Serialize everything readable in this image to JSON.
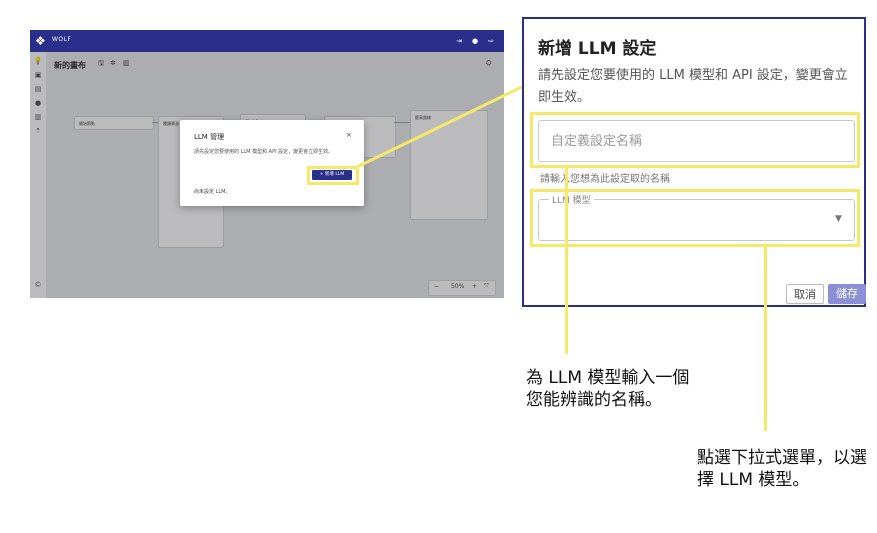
{
  "colors": {
    "brand": "#2b2f8c",
    "highlight": "#f5e96a",
    "save_disabled": "#8d8fd6"
  },
  "app": {
    "brand": "WOLF",
    "header_icons": [
      "login-icon",
      "user-icon",
      "logout-icon"
    ],
    "rail_icons": [
      "bulb-icon",
      "robot-icon",
      "book-icon",
      "chat-icon",
      "document-icon",
      "dot-icon",
      "help-icon"
    ],
    "canvas_title": "新的畫布",
    "toolbar_icons": [
      "save-icon",
      "settings-icon",
      "delete-icon"
    ],
    "nodes": [
      {
        "title": "開始節點"
      },
      {
        "title": "種類資源"
      },
      {
        "title": "Chat Bot"
      },
      {
        "title": "Chat Bot 摘要"
      },
      {
        "title": "聽寫器樣"
      }
    ],
    "zoom": {
      "minus": "−",
      "level": "50%",
      "plus": "+",
      "fit": "⤧"
    }
  },
  "modal": {
    "title": "LLM 管理",
    "close": "×",
    "description": "請先設定您要使用的 LLM 模型和 API 設定，變更會立即生效。",
    "add_button": "+ 新增 LLM",
    "empty_text": "尚未設定 LLM。"
  },
  "dialog": {
    "title": "新增 LLM 設定",
    "description": "請先設定您要使用的 LLM 模型和 API 設定，變更會立即生效。",
    "name_placeholder": "自定義設定名稱",
    "name_helper": "請輸入您想為此設定取的名稱",
    "model_label": "LLM 模型",
    "model_value": "",
    "cancel": "取消",
    "save": "儲存"
  },
  "annotations": {
    "name_hint": "為 LLM 模型輸入一個您能辨識的名稱。",
    "model_hint": "點選下拉式選單，以選擇 LLM 模型。"
  }
}
